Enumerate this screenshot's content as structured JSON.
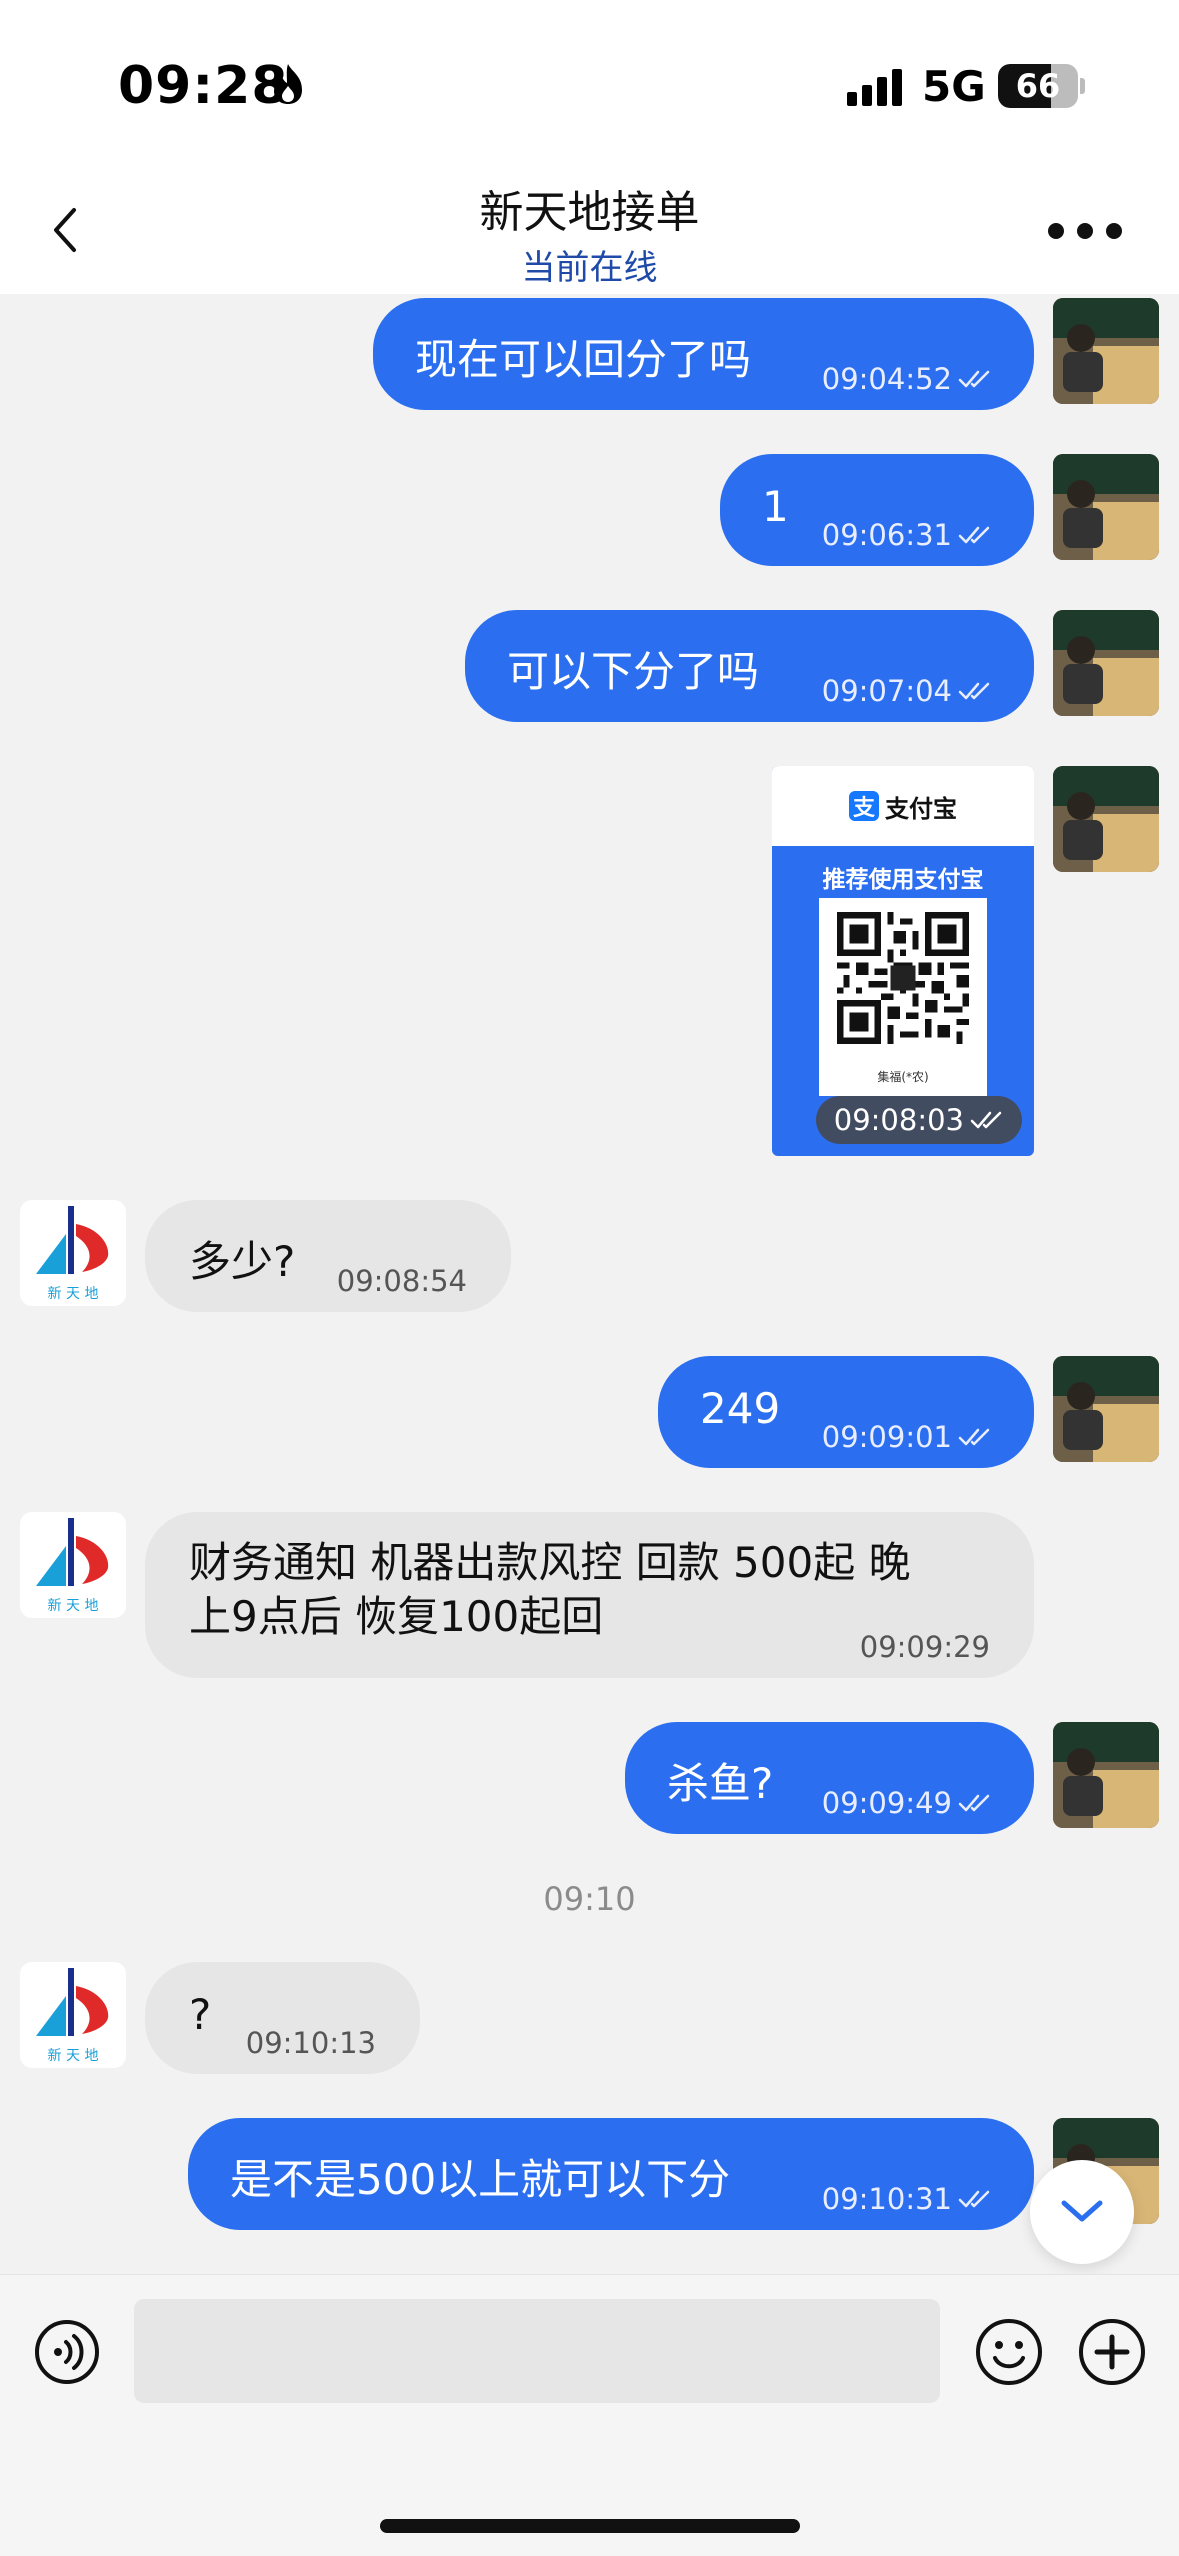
{
  "status_bar": {
    "time": "09:28",
    "network": "5G",
    "battery": "66",
    "battery_level": 0.66
  },
  "header": {
    "title": "新天地接单",
    "subtitle": "当前在线"
  },
  "messages": [
    {
      "text": "现在可以回分了吗",
      "time": "09:04:52"
    },
    {
      "text": "1",
      "time": "09:06:31"
    },
    {
      "text": "可以下分了吗",
      "time": "09:07:04"
    },
    {
      "image": {
        "brand": "支付宝",
        "badge": "支",
        "promo": "推荐使用支付宝",
        "caption": "集福(*农)"
      },
      "time": "09:08:03"
    },
    {
      "text": "多少?",
      "time": "09:08:54"
    },
    {
      "text": "249",
      "time": "09:09:01"
    },
    {
      "lines": [
        "财务通知  机器出款风控 回款  500起 晚",
        "上9点后 恢复100起回"
      ],
      "time": "09:09:29"
    },
    {
      "text": "杀鱼?",
      "time": "09:09:49"
    },
    {
      "text": "?",
      "time": "09:10:13"
    },
    {
      "text": "是不是500以上就可以下分",
      "time": "09:10:31"
    }
  ],
  "avatar_other": {
    "caption": "新 天 地"
  },
  "time_divider": "09:10",
  "input": {
    "value": ""
  },
  "icons": {
    "back": "chevron-left-icon",
    "more": "more-dots-icon",
    "read": "double-check-icon",
    "scroll": "chevron-down-icon",
    "voice": "voice-icon",
    "emoji": "emoji-icon",
    "plus": "plus-icon"
  },
  "colors": {
    "accent": "#2b6ff0",
    "subtitle": "#1f4aa8",
    "incoming": "#e6e6e6",
    "background": "#f2f2f2"
  }
}
